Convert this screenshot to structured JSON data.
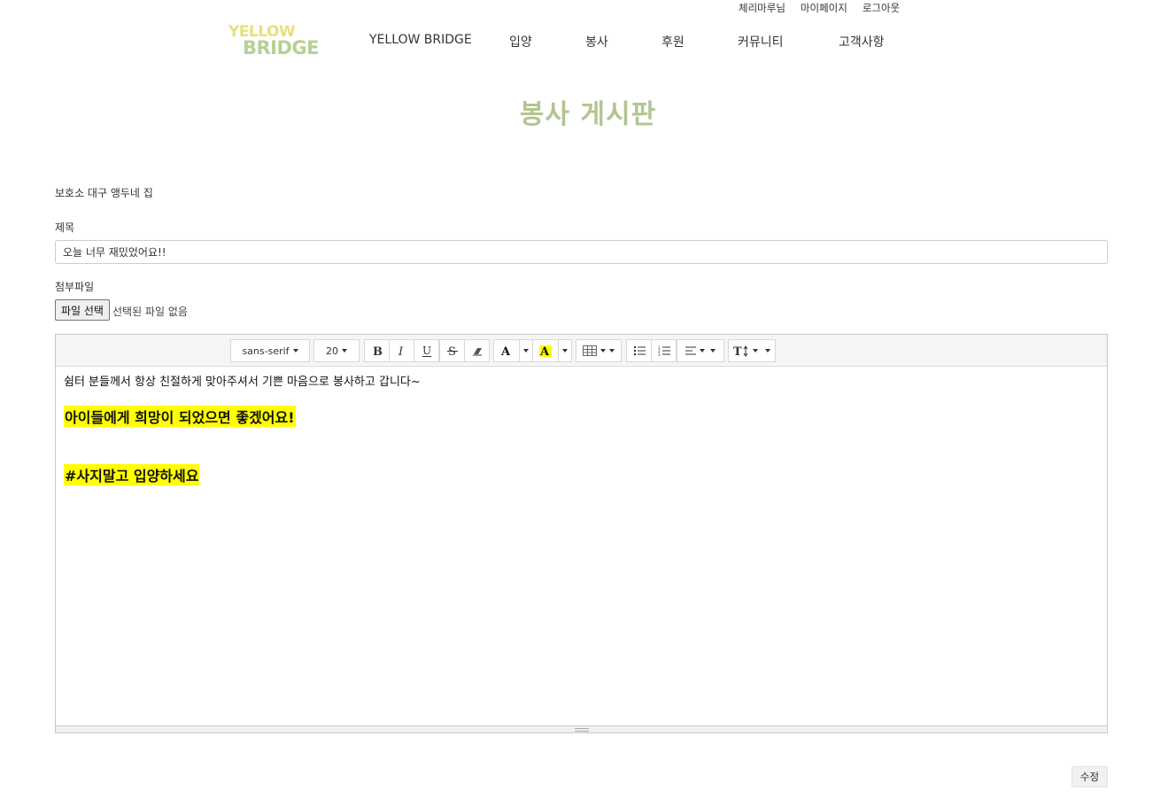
{
  "header": {
    "util_links": [
      "체리마루님",
      "마이페이지",
      "로그아웃"
    ],
    "logo": {
      "line1": "YELLOW",
      "line2": "BRIDGE"
    },
    "nav": [
      "YELLOW BRIDGE",
      "입양",
      "봉사",
      "후원",
      "커뮤니티",
      "고객사항"
    ]
  },
  "page": {
    "title": "봉사 게시판",
    "shelter": "보호소 대구 앵두네 집",
    "subject_label": "제목",
    "subject_value": "오늘 너무 재밌었어요!!",
    "file_label": "첨부파일",
    "file_button": "파일 선택",
    "file_status": "선택된 파일 없음",
    "submit_label": "수정"
  },
  "editor": {
    "toolbar": {
      "font_name": "sans-serif",
      "font_size": "20"
    },
    "content": {
      "line1": "쉼터 분들께서 항상 친절하게 맞아주셔서 기쁜 마음으로 봉사하고 갑니다~",
      "highlight1": "아이들에게 희망이 되었으면 좋겠어요!",
      "highlight2": "#사지말고 입양하세요"
    }
  },
  "colors": {
    "accent": "#b2c592",
    "logo_yellow": "#e8e07a",
    "logo_green": "#b9cf95",
    "highlight": "#ffff00"
  }
}
